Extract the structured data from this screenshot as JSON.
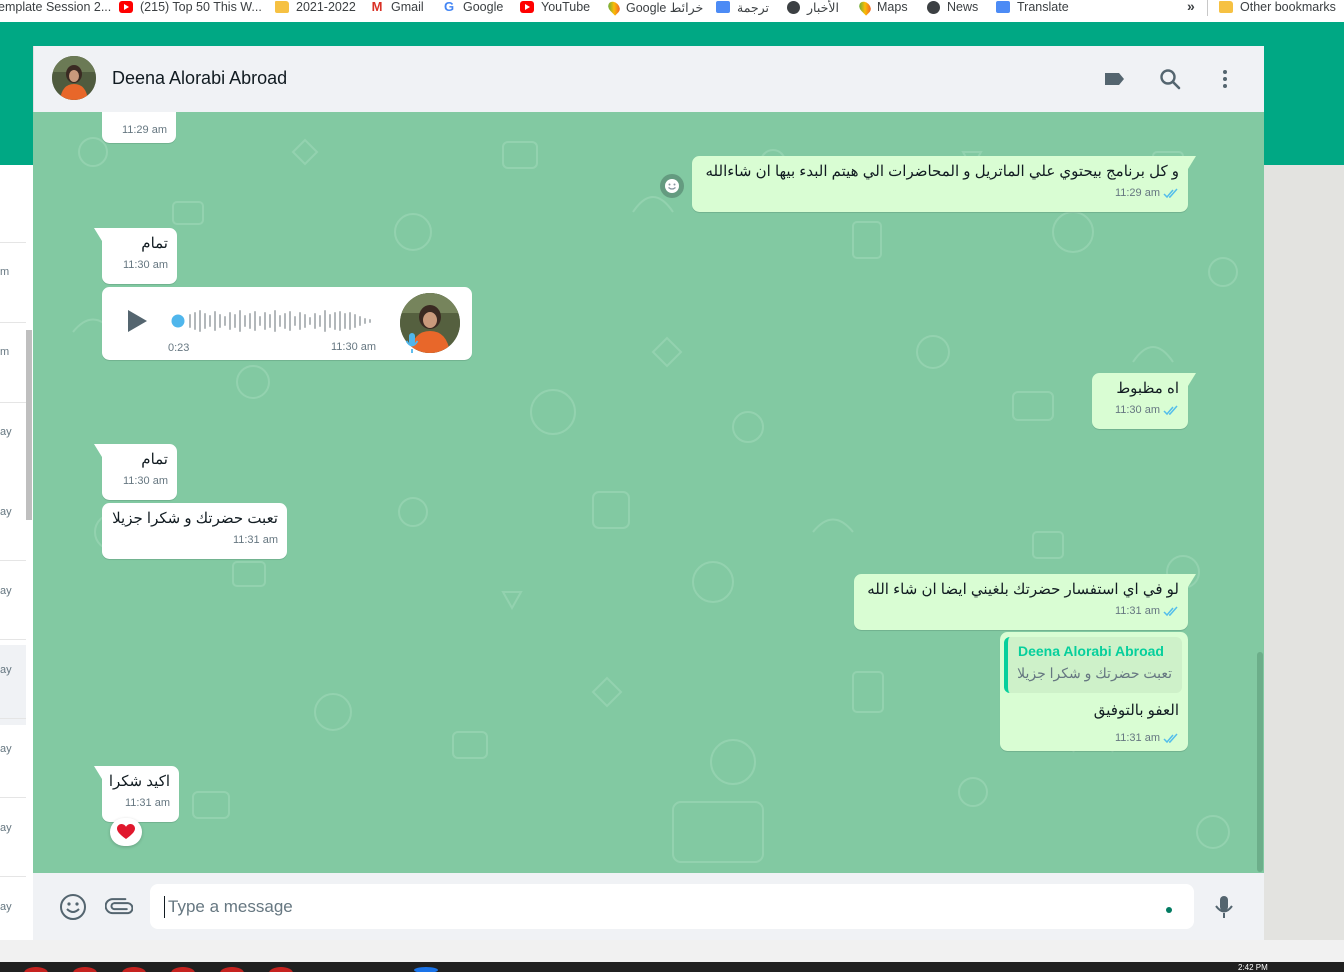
{
  "bookmarks": {
    "items": [
      {
        "label": "emplate Session 2...",
        "icon": "folder-icon"
      },
      {
        "label": "(215) Top 50 This W...",
        "icon": "youtube-icon"
      },
      {
        "label": "2021-2022",
        "icon": "folder-icon"
      },
      {
        "label": "Gmail",
        "icon": "gmail-icon"
      },
      {
        "label": "Google",
        "icon": "google-icon"
      },
      {
        "label": "YouTube",
        "icon": "youtube-icon"
      },
      {
        "label": "Google خرائط",
        "icon": "maps-icon"
      },
      {
        "label": "ترجمة",
        "icon": "translate-icon"
      },
      {
        "label": "الأخبار",
        "icon": "news-icon"
      },
      {
        "label": "Maps",
        "icon": "maps-icon"
      },
      {
        "label": "News",
        "icon": "news-icon"
      },
      {
        "label": "Translate",
        "icon": "translate-icon"
      }
    ],
    "overflow": "»",
    "other": "Other bookmarks"
  },
  "sidebar_fragments": [
    "m",
    "m",
    "ay",
    "ay",
    "ay",
    "ay",
    "ay",
    "ay",
    "ay"
  ],
  "chat": {
    "contact_name": "Deena Alorabi Abroad",
    "header_icons": [
      "label-icon",
      "search-icon",
      "menu-icon"
    ],
    "messages": [
      {
        "id": "m0",
        "direction": "in",
        "text": "",
        "time": "11:29 am"
      },
      {
        "id": "m1",
        "direction": "out",
        "text": "و كل برنامج بيحتوي علي الماتريل و المحاضرات الي هيتم البدء بيها ان شاءالله",
        "time": "11:29 am",
        "read": true
      },
      {
        "id": "m2",
        "direction": "in",
        "text": "تمام",
        "time": "11:30 am"
      },
      {
        "id": "m3",
        "direction": "in",
        "type": "voice",
        "duration": "0:23",
        "time": "11:30 am"
      },
      {
        "id": "m4",
        "direction": "out",
        "text": "اه مظبوط",
        "time": "11:30 am",
        "read": true
      },
      {
        "id": "m5",
        "direction": "in",
        "text": "تمام",
        "time": "11:30 am"
      },
      {
        "id": "m6",
        "direction": "in",
        "text": "تعبت حضرتك و شكرا جزيلا",
        "time": "11:31 am"
      },
      {
        "id": "m7",
        "direction": "out",
        "text": "لو في اي استفسار حضرتك بلغيني ايضا ان شاء الله",
        "time": "11:31 am",
        "read": true
      },
      {
        "id": "m8",
        "direction": "out",
        "text": "العفو بالتوفيق",
        "time": "11:31 am",
        "read": true,
        "quoted": {
          "author": "Deena Alorabi Abroad",
          "text": "تعبت حضرتك و شكرا جزيلا"
        }
      },
      {
        "id": "m9",
        "direction": "in",
        "text": "اكيد شكرا",
        "time": "11:31 am",
        "reaction": "❤️"
      }
    ]
  },
  "composer": {
    "placeholder": "Type a message",
    "icons": [
      "emoji-icon",
      "attach-icon",
      "mic-icon"
    ]
  },
  "taskbar": {
    "clock": "2:42 PM"
  },
  "colors": {
    "header_bg": "#f0f2f5",
    "chat_bg": "#82c9a2",
    "incoming_bubble": "#ffffff",
    "outgoing_bubble": "#d9fdd3",
    "read_ticks": "#53bdeb",
    "accent": "#00a884"
  }
}
